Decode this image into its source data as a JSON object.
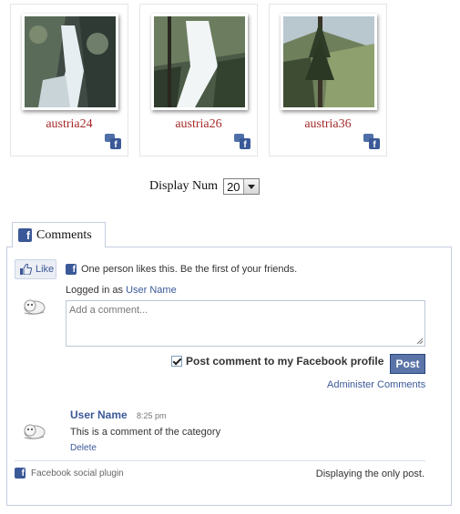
{
  "gallery": {
    "items": [
      {
        "caption": "austria24"
      },
      {
        "caption": "austria26"
      },
      {
        "caption": "austria36"
      }
    ]
  },
  "display": {
    "label": "Display Num",
    "selected": "20"
  },
  "comments": {
    "tab_label": "Comments",
    "like_label": "Like",
    "like_text": "One person likes this. Be the first of your friends.",
    "logged_in_prefix": "Logged in as",
    "user_name": "User Name",
    "placeholder": "Add a comment...",
    "post_to_profile": "Post comment to my Facebook profile",
    "post_checked": true,
    "post_button": "Post",
    "administer": "Administer Comments",
    "entries": [
      {
        "author": "User Name",
        "time": "8:25 pm",
        "body": "This is a comment of the category",
        "delete": "Delete"
      }
    ],
    "footer_plugin": "Facebook social plugin",
    "footer_status": "Displaying the only post."
  },
  "colors": {
    "caption": "#a52a2a",
    "facebook_blue": "#3b5998",
    "post_button": "#5b74a8"
  }
}
